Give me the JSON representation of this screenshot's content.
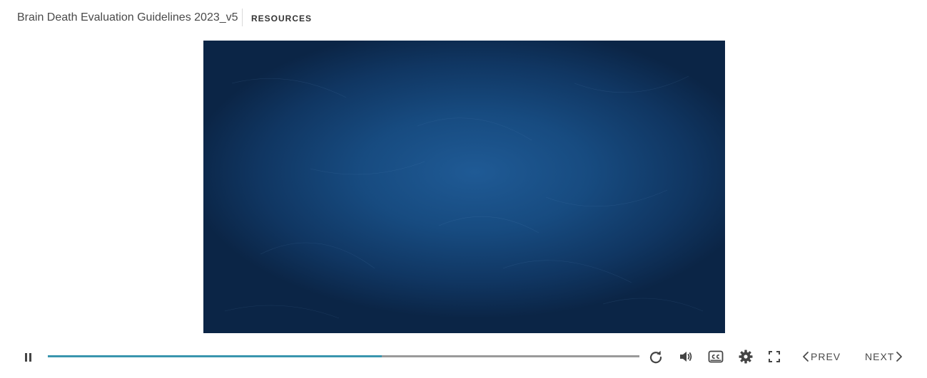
{
  "header": {
    "course_title": "Brain Death Evaluation Guidelines 2023_v5",
    "resources_label": "RESOURCES"
  },
  "player": {
    "progress_fraction": 0.565,
    "progress_color": "#3a95ae",
    "track_color": "#9a9a9a",
    "slide_background_color": "#174b80"
  },
  "controls": {
    "pause_icon": "pause-icon",
    "replay_icon": "replay-icon",
    "volume_icon": "volume-icon",
    "cc_icon": "closed-captions-icon",
    "settings_icon": "gear-icon",
    "fullscreen_icon": "fullscreen-icon",
    "prev_label": "PREV",
    "next_label": "NEXT"
  }
}
